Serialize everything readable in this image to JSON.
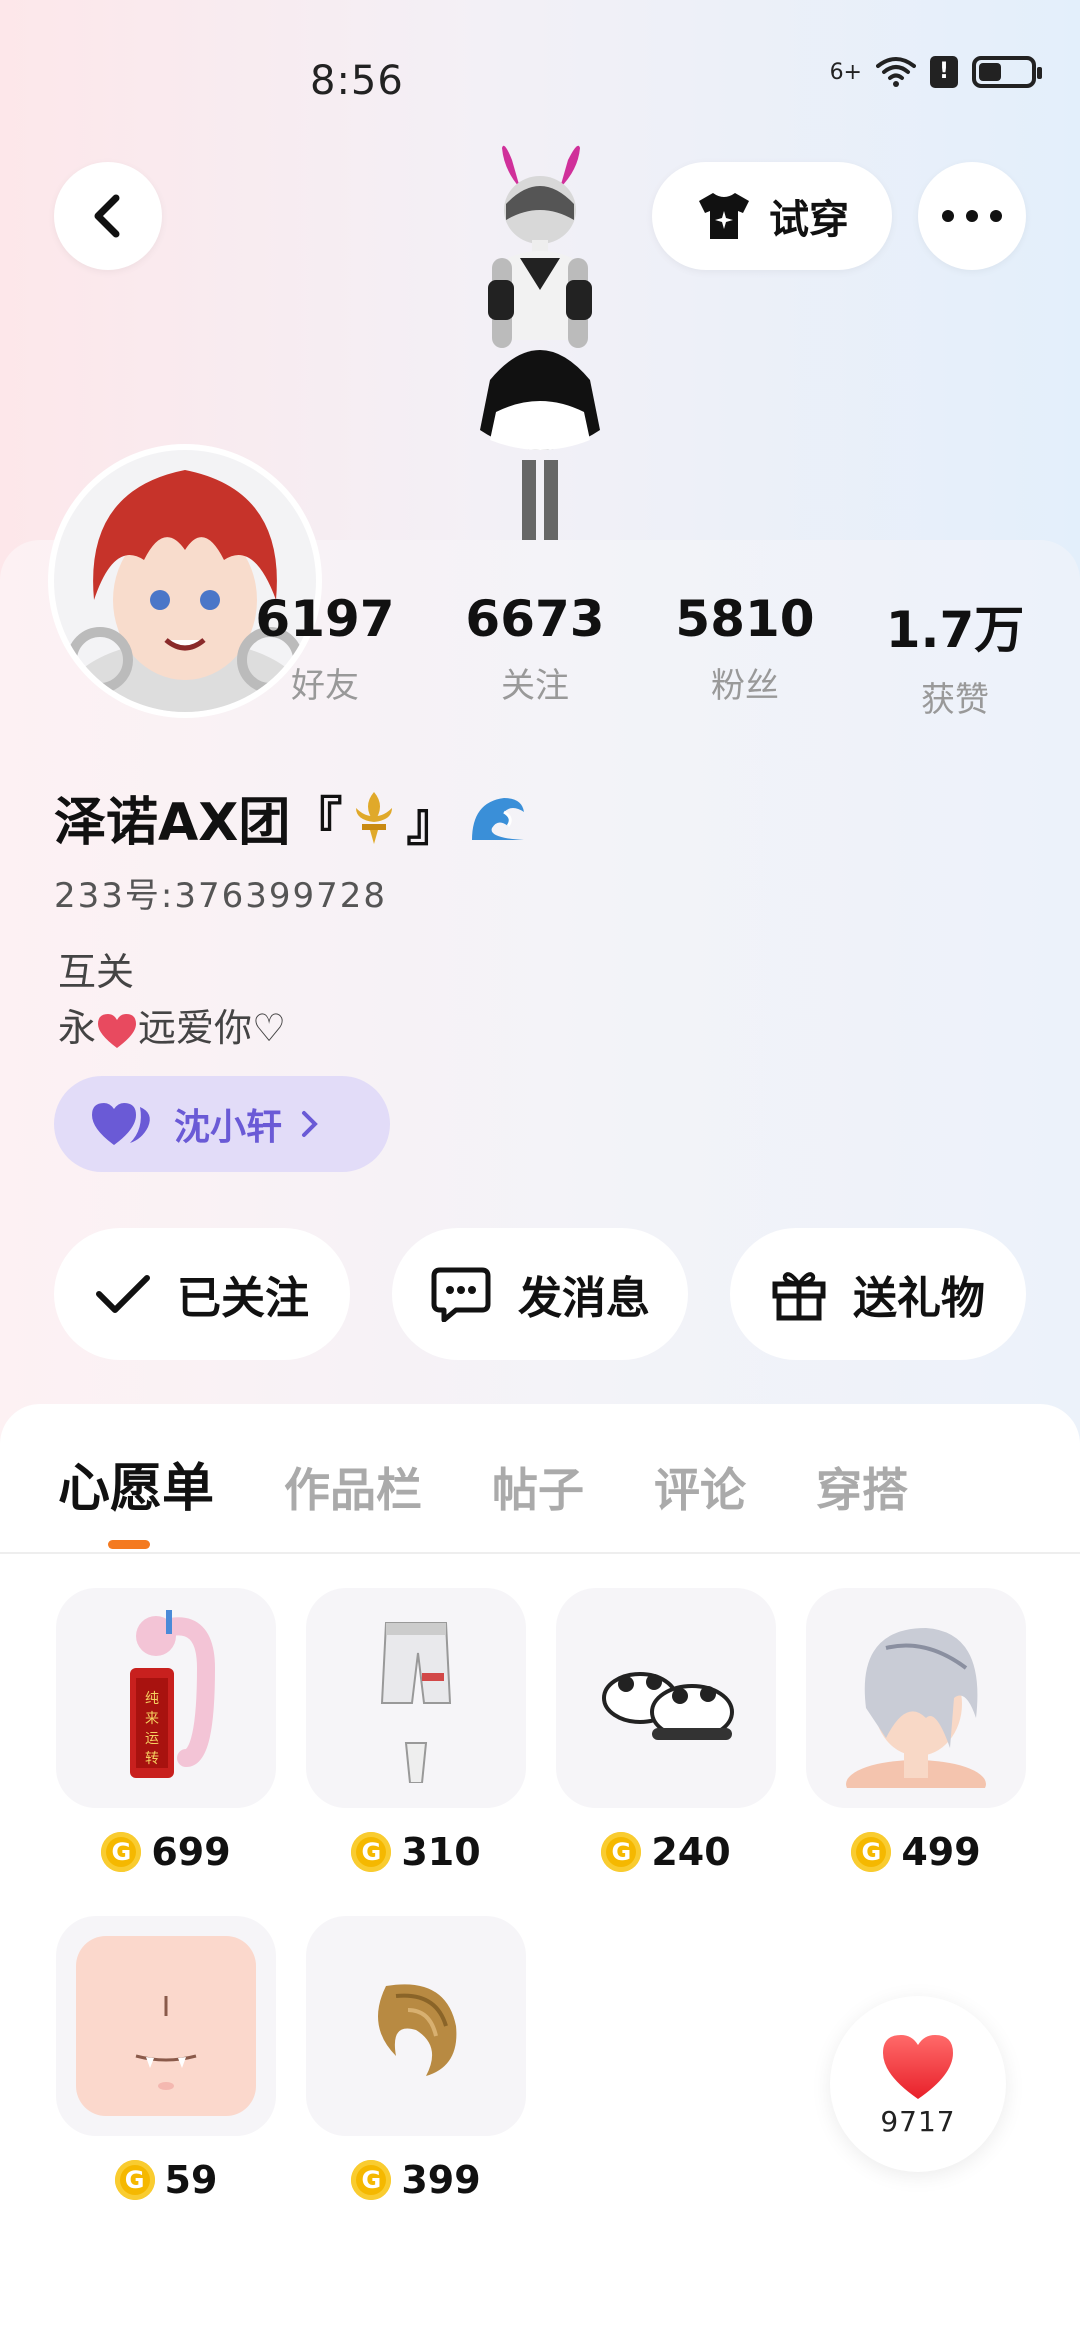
{
  "status_bar": {
    "time": "8:56",
    "signal_label": "6+",
    "battery_level": 0.4
  },
  "header": {
    "try_on_label": "试穿"
  },
  "stats": [
    {
      "value": "6197",
      "label": "好友"
    },
    {
      "value": "6673",
      "label": "关注"
    },
    {
      "value": "5810",
      "label": "粉丝"
    },
    {
      "value": "1.7万",
      "label": "获赞"
    }
  ],
  "profile": {
    "name_prefix": "泽诺AX团『",
    "name_suffix": "』",
    "uid": "233号:376399728",
    "bio_line1": "互关",
    "bio_line2_start": "永",
    "bio_line2_end": "远爱你♡",
    "partner_name": "沈小轩"
  },
  "actions": {
    "following_label": "已关注",
    "message_label": "发消息",
    "gift_label": "送礼物"
  },
  "tabs": [
    "心愿单",
    "作品栏",
    "帖子",
    "评论",
    "穿搭"
  ],
  "wishlist": [
    {
      "price": "699",
      "icon": "firecracker-dragon-item"
    },
    {
      "price": "310",
      "icon": "shorts-item"
    },
    {
      "price": "240",
      "icon": "panda-shoes-item"
    },
    {
      "price": "499",
      "icon": "silver-hair-item"
    },
    {
      "price": "59",
      "icon": "fang-face-item"
    },
    {
      "price": "399",
      "icon": "fur-tail-item"
    }
  ],
  "like_fab": {
    "count": "9717"
  },
  "colors": {
    "accent": "#f47a20",
    "partner_bg": "#e2dcf8",
    "partner_text": "#6a5ad6",
    "coin": "#f5b800"
  }
}
